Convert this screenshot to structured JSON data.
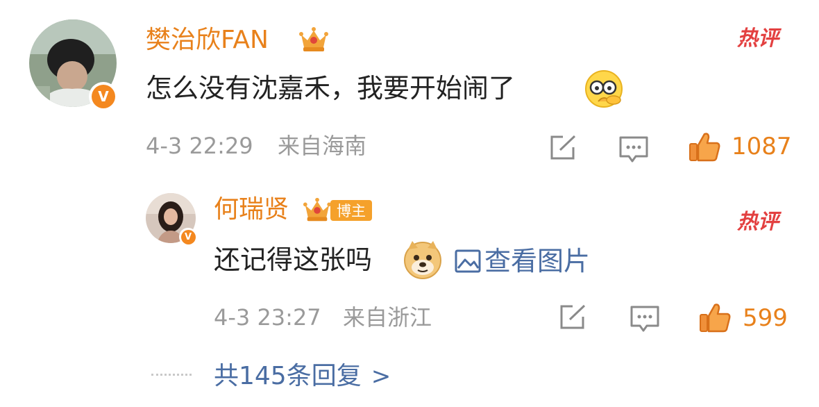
{
  "comment": {
    "username": "樊治欣FAN",
    "hot_label": "热评",
    "text": "怎么没有沈嘉禾，我要开始闹了",
    "emoji_icon": "shocked-face-emoji",
    "timestamp": "4-3 22:29",
    "location": "来自海南",
    "like_count": "1087",
    "verified_badge": "V",
    "crown_icon": "crown-icon"
  },
  "reply": {
    "username": "何瑞贤",
    "badge_label": "博主",
    "hot_label": "热评",
    "text": "还记得这张吗",
    "emoji_icon": "doge-emoji",
    "view_image_label": "查看图片",
    "timestamp": "4-3 23:27",
    "location": "来自浙江",
    "like_count": "599",
    "verified_badge": "V"
  },
  "more_replies": {
    "label": "共145条回复",
    "arrow": ">"
  },
  "colors": {
    "username": "#e8811b",
    "hot": "#e34040",
    "link": "#4a6da3",
    "meta": "#9a9a9a",
    "verified": "#f4881f"
  }
}
